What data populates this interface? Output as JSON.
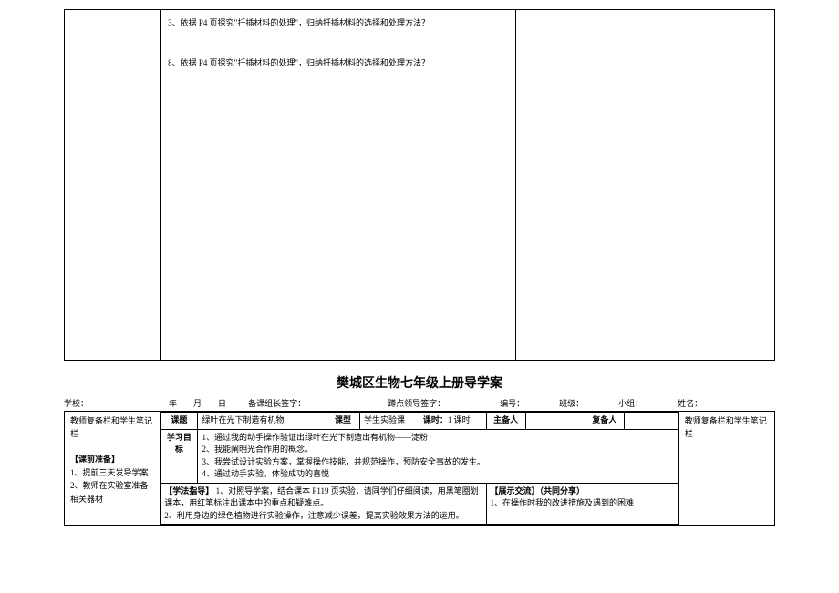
{
  "upper": {
    "q3": "3、依据 P4 页探究\"扦插材料的处理\"，归纳扦插材料的选择和处理方法？",
    "q8": "8、依据 P4 页探究\"扦插材料的处理\"，归纳扦插材料的选择和处理方法？"
  },
  "title": "樊城区生物七年级上册导学案",
  "header": {
    "school": "学校：",
    "year": "年",
    "month": "月",
    "day": "日",
    "prep_sign": "备课组长签字：",
    "leader_sign": "蹲点领导签字：",
    "id": "编号：",
    "class": "班级：",
    "group": "小组：",
    "name": "姓名："
  },
  "left_margin": {
    "title": "教师复备栏和学生笔记栏",
    "prep_heading": "【课前准备】",
    "prep1": "1、提前三天发导学案",
    "prep2": "2、教师在实验室准备相关器材"
  },
  "right_margin": {
    "title": "教师复备栏和学生笔记栏"
  },
  "row1": {
    "topic_lab": "课题",
    "topic_val": "绿叶在光下制造有机物",
    "type_lab": "课型",
    "type_val": "学生实验课",
    "time_lab": "课时：",
    "time_val": "1 课时",
    "host_lab": "主备人",
    "reviewer_lab": "复备人"
  },
  "objectives": {
    "lab": "学习目标",
    "o1": "1、通过我的动手操作验证出绿叶在光下制造出有机物——淀粉",
    "o2": "2、我能阐明光合作用的概念。",
    "o3": "3、我尝试设计实验方案，掌握操作技能，并规范操作，预防安全事故的发生。",
    "o4": "4、通过动手实验，体验成功的喜悦"
  },
  "methods": {
    "heading": "【学法指导】",
    "m1": "1、对照导学案，结合课本 P119 页实验，请同学们仔细阅读，用黑笔圈划课本，用红笔标注出课本中的重点和疑难点。",
    "m2": "2、利用身边的绿色植物进行实验操作，注意减少误差，提高实验效果方法的运用。"
  },
  "share": {
    "heading": "【展示交流】（共同分享）",
    "s1": "1、在操作时我的改进措施及遇到的困难"
  }
}
